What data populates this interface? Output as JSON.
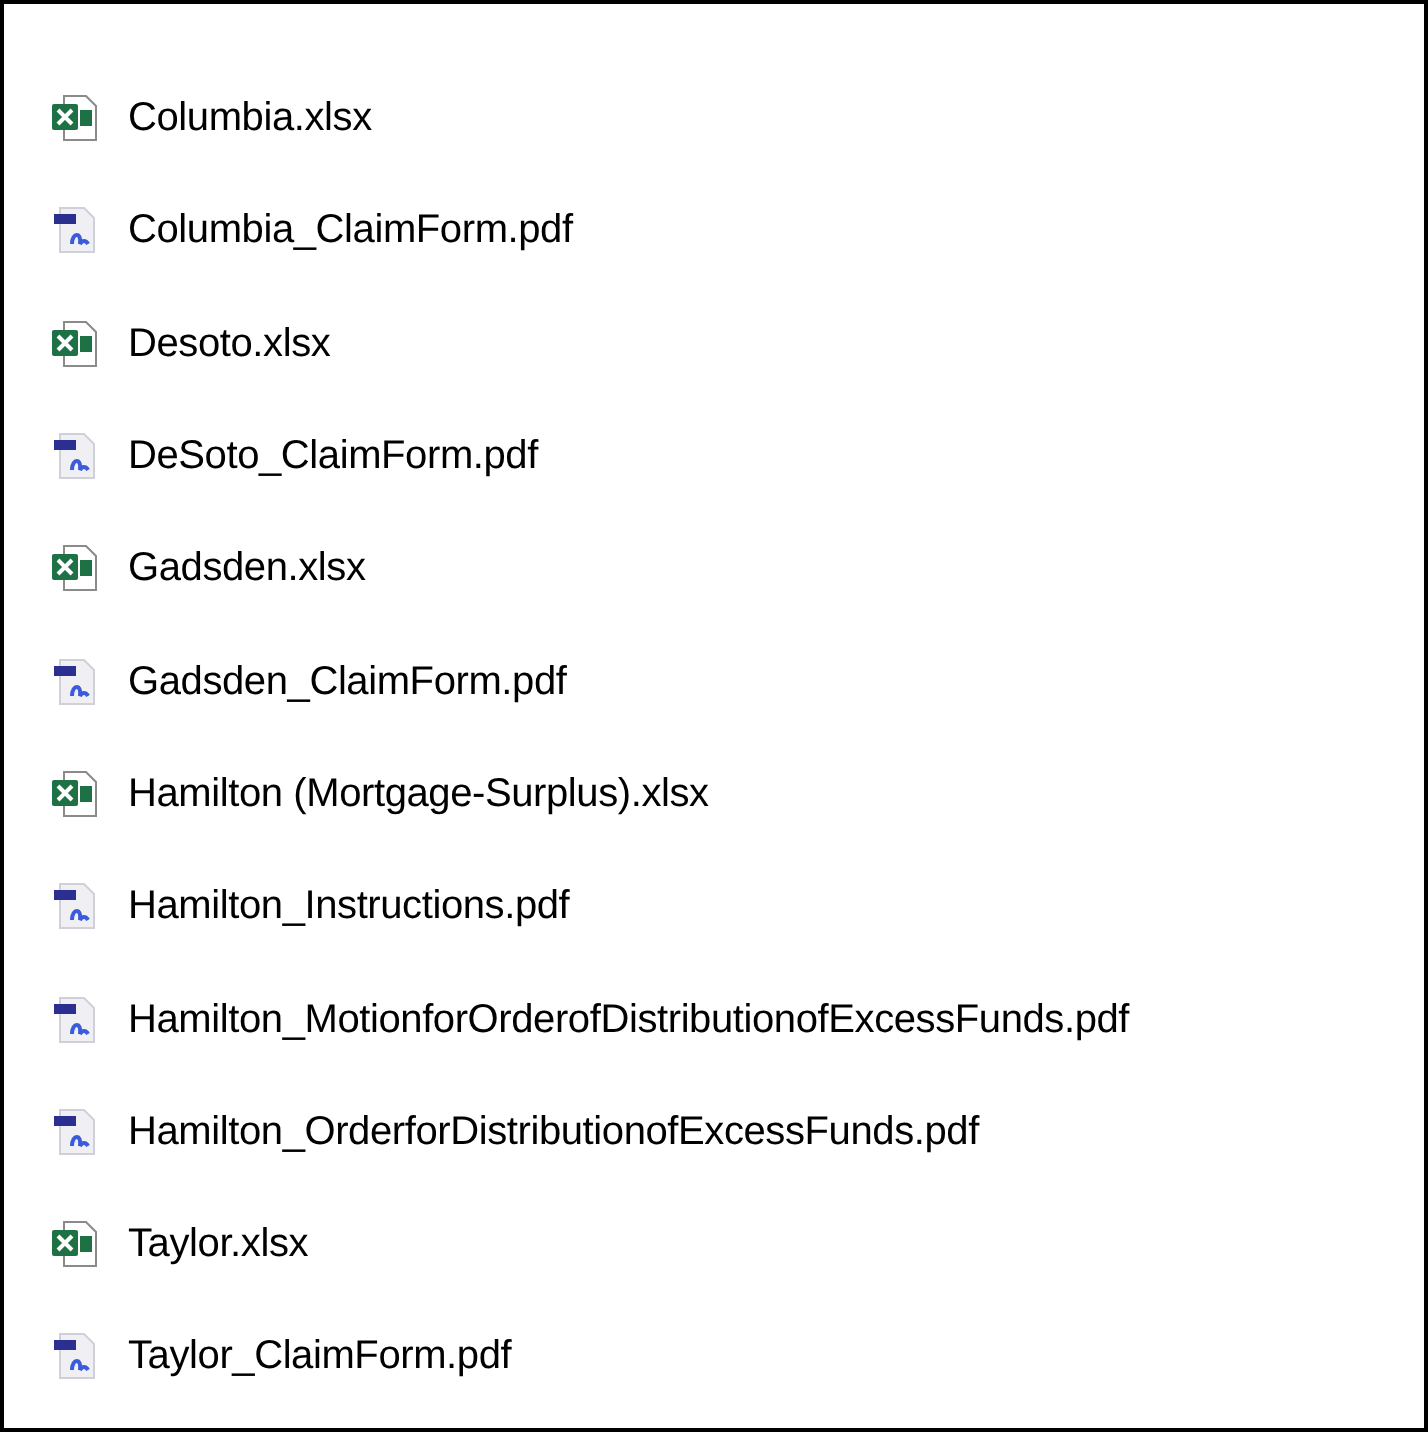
{
  "files": [
    {
      "name": "Columbia.xlsx",
      "kind": "excel"
    },
    {
      "name": "Columbia_ClaimForm.pdf",
      "kind": "pdf"
    },
    {
      "name": "Desoto.xlsx",
      "kind": "excel"
    },
    {
      "name": "DeSoto_ClaimForm.pdf",
      "kind": "pdf"
    },
    {
      "name": "Gadsden.xlsx",
      "kind": "excel"
    },
    {
      "name": "Gadsden_ClaimForm.pdf",
      "kind": "pdf"
    },
    {
      "name": "Hamilton (Mortgage-Surplus).xlsx",
      "kind": "excel"
    },
    {
      "name": "Hamilton_Instructions.pdf",
      "kind": "pdf"
    },
    {
      "name": "Hamilton_MotionforOrderofDistributionofExcessFunds.pdf",
      "kind": "pdf"
    },
    {
      "name": "Hamilton_OrderforDistributionofExcessFunds.pdf",
      "kind": "pdf"
    },
    {
      "name": "Taylor.xlsx",
      "kind": "excel"
    },
    {
      "name": "Taylor_ClaimForm.pdf",
      "kind": "pdf"
    }
  ]
}
